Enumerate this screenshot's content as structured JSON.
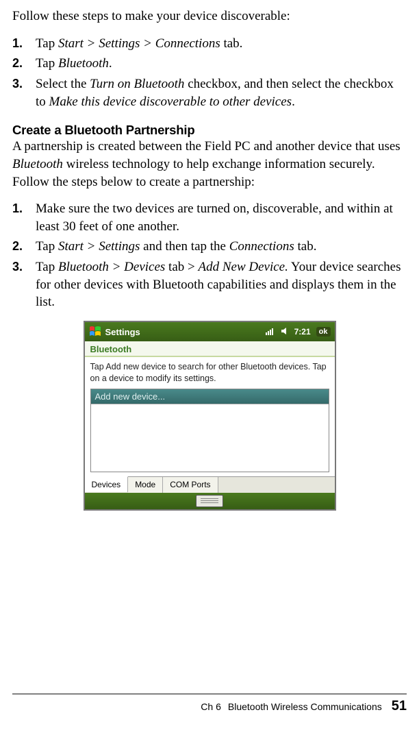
{
  "intro1": "Follow these steps to make your device discoverable:",
  "stepsA": [
    {
      "pre": "Tap ",
      "em": "Start > Settings > Connections",
      "post": " tab."
    },
    {
      "pre": "Tap ",
      "em": "Bluetooth",
      "post": "."
    },
    {
      "pre": "Select the ",
      "em": "Turn on Bluetooth",
      "mid": " checkbox, and then select the checkbox to ",
      "em2": "Make this device discoverable to other devices",
      "post2": "."
    }
  ],
  "subhead": "Create a Bluetooth Partnership",
  "para2_a": "A partnership is created between the Field PC and another device that uses ",
  "para2_em": "Bluetooth",
  "para2_b": " wireless technology to help exchange information securely. Follow the steps below to create a partnership:",
  "stepsB": [
    {
      "text": "Make sure the two devices are turned on, discoverable, and within at least 30 feet of one another."
    },
    {
      "pre": "Tap ",
      "em": "Start > Settings",
      "mid": " and then tap the ",
      "em2": "Connections",
      "post2": " tab."
    },
    {
      "pre": "Tap ",
      "em": "Bluetooth > Devices",
      "mid": " tab > ",
      "em2": "Add New Device.",
      "post2": " Your device searches for other devices with Bluetooth capabilities and displays them in the list."
    }
  ],
  "device": {
    "statusTitle": "Settings",
    "time": "7:21",
    "ok": "ok",
    "screenTitle": "Bluetooth",
    "instructions": "Tap Add new device to search for other Bluetooth devices. Tap on a device to modify its settings.",
    "addItem": "Add new device...",
    "tabs": [
      "Devices",
      "Mode",
      "COM Ports"
    ]
  },
  "footer": {
    "chapter": "Ch 6",
    "title": "Bluetooth Wireless Communications",
    "page": "51"
  }
}
